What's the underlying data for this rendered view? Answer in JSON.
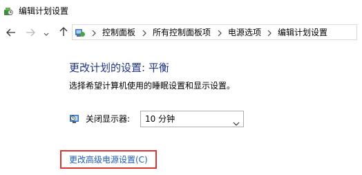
{
  "window": {
    "title": "编辑计划设置",
    "icon": "power-options-icon"
  },
  "nav": {
    "back_icon": "arrow-left-icon",
    "forward_icon": "arrow-right-icon",
    "recent_icon": "chevron-down-icon",
    "up_icon": "arrow-up-icon"
  },
  "address": {
    "icon": "control-panel-icon",
    "separator": "chevron-right-icon",
    "crumbs": [
      "控制面板",
      "所有控制面板项",
      "电源选项",
      "编辑计划设置"
    ]
  },
  "main": {
    "heading": "更改计划的设置: 平衡",
    "subtitle": "选择希望计算机使用的睡眠设置和显示设置。",
    "display_off": {
      "icon": "monitor-clock-icon",
      "label": "关闭显示器:",
      "value": "10 分钟"
    },
    "advanced_link": "更改高级电源设置(C)"
  },
  "colors": {
    "heading": "#1e3287",
    "link": "#1c5cb7",
    "highlight_box": "#d9352e"
  }
}
